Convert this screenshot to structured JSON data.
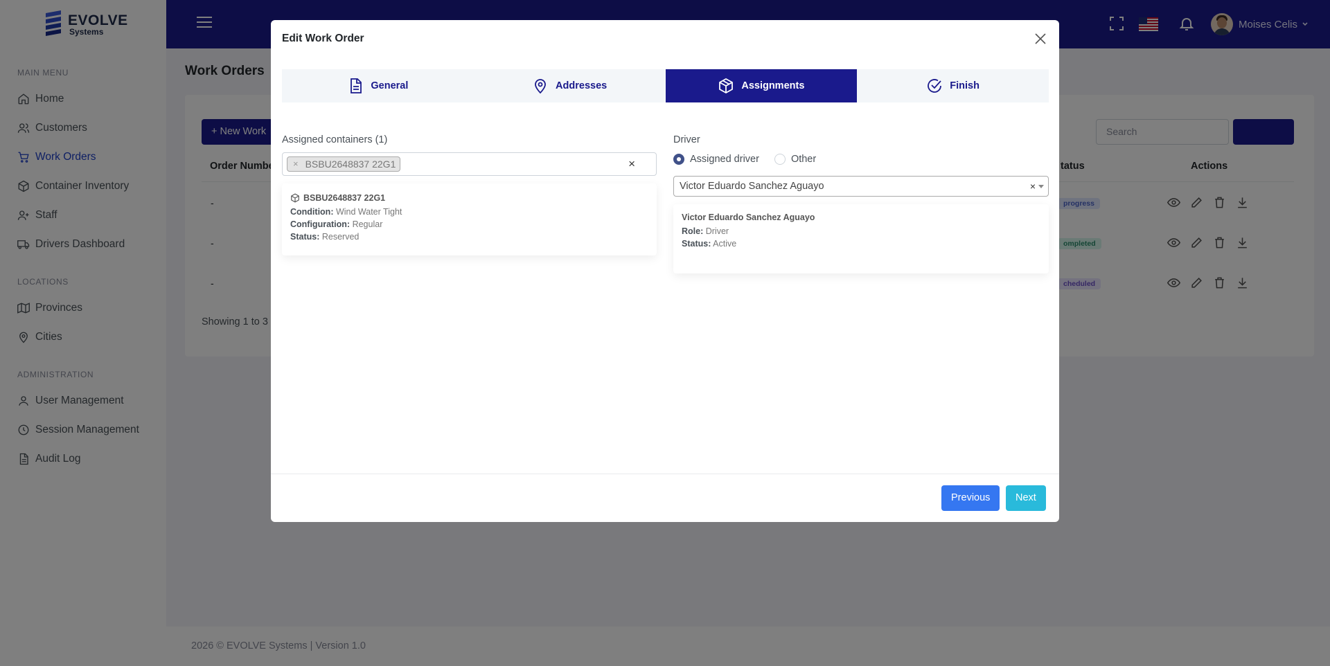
{
  "app": {
    "logo_name": "EVOLVE",
    "logo_sub": "Systems"
  },
  "sidebar": {
    "sections": [
      {
        "title": "MAIN MENU"
      },
      {
        "title": "LOCATIONS"
      },
      {
        "title": "ADMINISTRATION"
      }
    ],
    "items": [
      {
        "label": "Home",
        "icon": "home-icon"
      },
      {
        "label": "Customers",
        "icon": "users-icon"
      },
      {
        "label": "Work Orders",
        "icon": "cart-icon",
        "active": true
      },
      {
        "label": "Container Inventory",
        "icon": "box-icon"
      },
      {
        "label": "Staff",
        "icon": "user-plus-icon"
      },
      {
        "label": "Drivers Dashboard",
        "icon": "truck-icon"
      },
      {
        "label": "Provinces",
        "icon": "map-icon"
      },
      {
        "label": "Cities",
        "icon": "pin-icon"
      },
      {
        "label": "User Management",
        "icon": "user-icon"
      },
      {
        "label": "Session Management",
        "icon": "clock-icon"
      },
      {
        "label": "Audit Log",
        "icon": "document-icon"
      }
    ]
  },
  "header": {
    "user_name": "Moises Celis"
  },
  "page": {
    "title": "Work Orders",
    "new_button": "+ New Work",
    "search_placeholder": "Search",
    "columns": {
      "order_number": "Order Numbe",
      "status": "tatus",
      "actions": "Actions"
    },
    "rows": [
      {
        "order": "-",
        "status": "progress"
      },
      {
        "order": "-",
        "status": "ompleted"
      },
      {
        "order": "-",
        "status": "cheduled"
      }
    ],
    "showing": "Showing 1 to 3"
  },
  "footer": {
    "text": "2026 © EVOLVE Systems | Version 1.0"
  },
  "modal": {
    "title": "Edit Work Order",
    "tabs": [
      {
        "label": "General",
        "icon": "document-icon"
      },
      {
        "label": "Addresses",
        "icon": "pin-icon"
      },
      {
        "label": "Assignments",
        "icon": "box-icon",
        "active": true
      },
      {
        "label": "Finish",
        "icon": "check-circle-icon"
      }
    ],
    "containers": {
      "label": "Assigned containers (1)",
      "chip": "BSBU2648837 22G1",
      "card": {
        "code": "BSBU2648837 22G1",
        "condition_label": "Condition:",
        "condition": "Wind Water Tight",
        "configuration_label": "Configuration:",
        "configuration": "Regular",
        "status_label": "Status:",
        "status": "Reserved"
      }
    },
    "driver": {
      "label": "Driver",
      "option_assigned": "Assigned driver",
      "option_other": "Other",
      "selected": "Victor Eduardo Sanchez Aguayo",
      "card": {
        "name": "Victor Eduardo Sanchez Aguayo",
        "role_label": "Role:",
        "role": "Driver",
        "status_label": "Status:",
        "status": "Active"
      }
    },
    "buttons": {
      "previous": "Previous",
      "next": "Next"
    }
  },
  "colors": {
    "primary": "#1a1a8c",
    "active_link": "#1e40c8",
    "btn_previous": "#3577f1",
    "btn_next": "#29badb"
  }
}
